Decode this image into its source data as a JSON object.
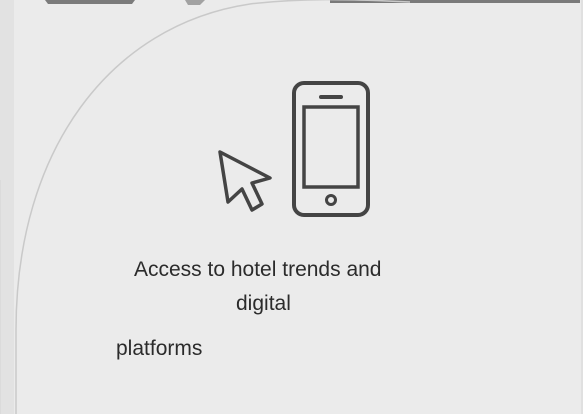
{
  "card": {
    "caption_line1": "Access to hotel trends and",
    "caption_line2": "digital",
    "caption_line3": "platforms"
  },
  "icons": {
    "pointer": "cursor-arrow-icon",
    "device": "smartphone-icon"
  },
  "colors": {
    "background": "#ebebeb",
    "arch_line": "#c9c9c9",
    "icon_stroke": "#444444",
    "text": "#2b2b2b"
  }
}
